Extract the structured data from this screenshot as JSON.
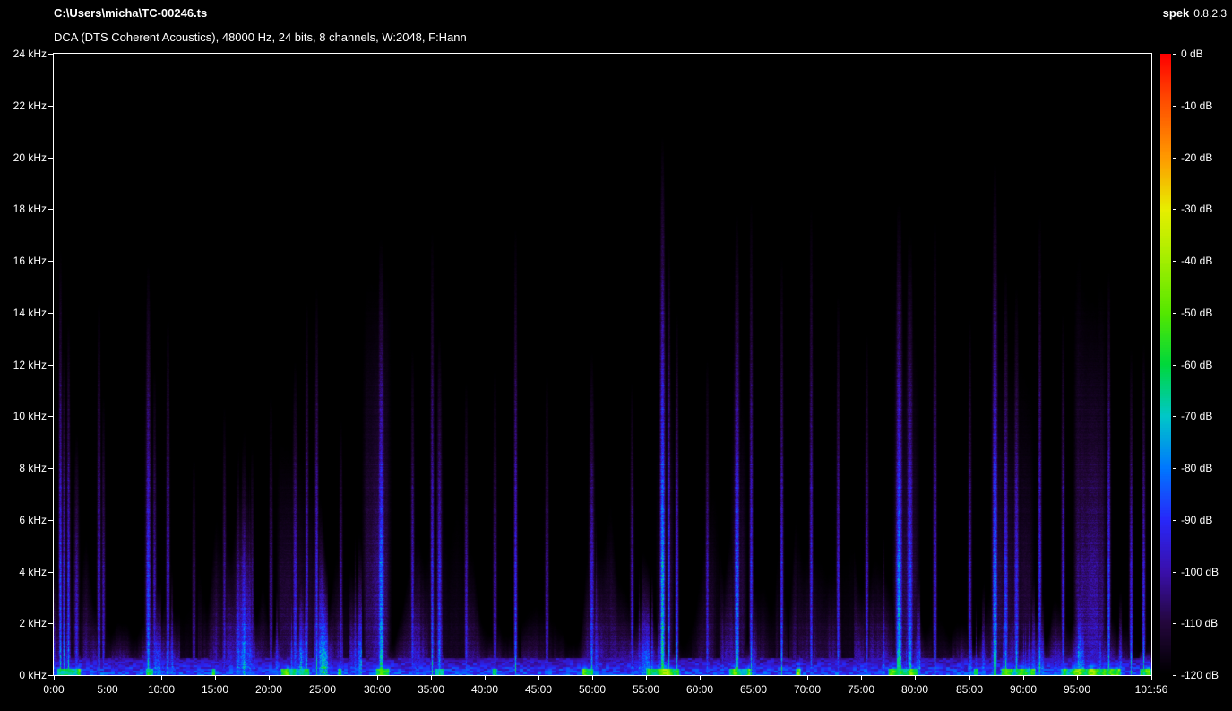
{
  "header": {
    "file_path": "C:\\Users\\micha\\TC-00246.ts",
    "stream_info": "DCA (DTS Coherent Acoustics), 48000 Hz, 24 bits, 8 channels, W:2048, F:Hann",
    "app_name": "spek",
    "app_version": "0.8.2.3"
  },
  "colors": {
    "background": "#000000",
    "text": "#ffffff",
    "plot_border": "#ffffff"
  },
  "chart_data": {
    "type": "heatmap",
    "title": "Audio spectrogram of TC-00246.ts",
    "grid": false,
    "legend_position": "right",
    "x": {
      "unit": "min:sec",
      "duration_minutes": 101.9333,
      "ticks": [
        "0:00",
        "5:00",
        "10:00",
        "15:00",
        "20:00",
        "25:00",
        "30:00",
        "35:00",
        "40:00",
        "45:00",
        "50:00",
        "55:00",
        "60:00",
        "65:00",
        "70:00",
        "75:00",
        "80:00",
        "85:00",
        "90:00",
        "95:00",
        "101:56"
      ]
    },
    "y": {
      "unit": "kHz",
      "min": 0,
      "max": 24,
      "ticks": [
        "24 kHz",
        "22 kHz",
        "20 kHz",
        "18 kHz",
        "16 kHz",
        "14 kHz",
        "12 kHz",
        "10 kHz",
        "8 kHz",
        "6 kHz",
        "4 kHz",
        "2 kHz",
        "0 kHz"
      ]
    },
    "z": {
      "unit": "dB",
      "min": -120,
      "max": 0,
      "ticks": [
        "0 dB",
        "-10 dB",
        "-20 dB",
        "-30 dB",
        "-40 dB",
        "-50 dB",
        "-60 dB",
        "-70 dB",
        "-80 dB",
        "-90 dB",
        "-100 dB",
        "-110 dB",
        "-120 dB"
      ]
    },
    "palette": [
      "#000000",
      "#24073c",
      "#3a10ac",
      "#2828fa",
      "#0078ff",
      "#00c8c8",
      "#00d83c",
      "#55e800",
      "#a2ee00",
      "#e8ee00",
      "#ff9a00",
      "#ff5400",
      "#ff0000"
    ],
    "events": [
      {
        "t": 0.55,
        "f": 16.6,
        "i": 0.34,
        "w": 2
      },
      {
        "t": 0.95,
        "f": 12.8,
        "i": 0.3,
        "w": 2
      },
      {
        "t": 1.3,
        "f": 13.9,
        "i": 0.32,
        "w": 2
      },
      {
        "t": 2.1,
        "f": 9.5,
        "i": 0.26,
        "w": 3
      },
      {
        "t": 4.15,
        "f": 14.6,
        "i": 0.3,
        "w": 2
      },
      {
        "t": 4.6,
        "f": 11.0,
        "i": 0.24,
        "w": 2
      },
      {
        "t": 8.75,
        "f": 16.1,
        "i": 0.34,
        "w": 3
      },
      {
        "t": 9.3,
        "f": 12.0,
        "i": 0.26,
        "w": 2
      },
      {
        "t": 10.55,
        "f": 13.9,
        "i": 0.3,
        "w": 2
      },
      {
        "t": 13.0,
        "f": 8.5,
        "i": 0.22,
        "w": 2
      },
      {
        "t": 15.8,
        "f": 10.5,
        "i": 0.24,
        "w": 2
      },
      {
        "t": 18.4,
        "f": 9.0,
        "i": 0.22,
        "w": 2
      },
      {
        "t": 20.1,
        "f": 11.0,
        "i": 0.24,
        "w": 2
      },
      {
        "t": 22.4,
        "f": 12.3,
        "i": 0.28,
        "w": 3
      },
      {
        "t": 23.5,
        "f": 14.7,
        "i": 0.26,
        "w": 2
      },
      {
        "t": 24.35,
        "f": 15.2,
        "i": 0.3,
        "w": 2
      },
      {
        "t": 26.6,
        "f": 10.0,
        "i": 0.24,
        "w": 2
      },
      {
        "t": 30.4,
        "f": 17.0,
        "i": 0.4,
        "w": 4
      },
      {
        "t": 33.3,
        "f": 12.8,
        "i": 0.28,
        "w": 2
      },
      {
        "t": 35.15,
        "f": 17.4,
        "i": 0.3,
        "w": 2
      },
      {
        "t": 35.75,
        "f": 13.3,
        "i": 0.32,
        "w": 3
      },
      {
        "t": 38.3,
        "f": 11.5,
        "i": 0.26,
        "w": 2
      },
      {
        "t": 40.9,
        "f": 12.0,
        "i": 0.26,
        "w": 2
      },
      {
        "t": 42.85,
        "f": 17.5,
        "i": 0.3,
        "w": 2
      },
      {
        "t": 45.8,
        "f": 11.8,
        "i": 0.25,
        "w": 2
      },
      {
        "t": 49.9,
        "f": 12.6,
        "i": 0.3,
        "w": 3
      },
      {
        "t": 53.7,
        "f": 11.5,
        "i": 0.26,
        "w": 2
      },
      {
        "t": 56.5,
        "f": 21.0,
        "i": 0.46,
        "w": 3
      },
      {
        "t": 57.1,
        "f": 17.0,
        "i": 0.32,
        "w": 2
      },
      {
        "t": 57.8,
        "f": 14.2,
        "i": 0.3,
        "w": 2
      },
      {
        "t": 60.7,
        "f": 12.4,
        "i": 0.27,
        "w": 2
      },
      {
        "t": 63.4,
        "f": 18.0,
        "i": 0.4,
        "w": 3
      },
      {
        "t": 64.7,
        "f": 18.6,
        "i": 0.3,
        "w": 2
      },
      {
        "t": 67.6,
        "f": 16.4,
        "i": 0.3,
        "w": 2
      },
      {
        "t": 70.3,
        "f": 18.4,
        "i": 0.28,
        "w": 2
      },
      {
        "t": 72.8,
        "f": 15.0,
        "i": 0.28,
        "w": 2
      },
      {
        "t": 75.5,
        "f": 13.4,
        "i": 0.26,
        "w": 2
      },
      {
        "t": 78.5,
        "f": 18.4,
        "i": 0.42,
        "w": 4
      },
      {
        "t": 79.5,
        "f": 17.2,
        "i": 0.34,
        "w": 4
      },
      {
        "t": 81.8,
        "f": 17.8,
        "i": 0.3,
        "w": 2
      },
      {
        "t": 85.0,
        "f": 14.0,
        "i": 0.26,
        "w": 2
      },
      {
        "t": 87.4,
        "f": 20.0,
        "i": 0.42,
        "w": 3
      },
      {
        "t": 88.4,
        "f": 15.8,
        "i": 0.32,
        "w": 3
      },
      {
        "t": 89.4,
        "f": 15.2,
        "i": 0.3,
        "w": 3
      },
      {
        "t": 91.5,
        "f": 18.1,
        "i": 0.3,
        "w": 2
      },
      {
        "t": 93.7,
        "f": 14.2,
        "i": 0.28,
        "w": 2
      },
      {
        "t": 97.9,
        "f": 15.8,
        "i": 0.34,
        "w": 2
      },
      {
        "t": 100.0,
        "f": 12.8,
        "i": 0.3,
        "w": 2
      },
      {
        "t": 101.2,
        "f": 13.0,
        "i": 0.3,
        "w": 2
      }
    ],
    "patches": [
      {
        "t0": 28.6,
        "t1": 31.3,
        "f": 15.8,
        "i": 0.14
      },
      {
        "t0": 20.6,
        "t1": 24.6,
        "f": 9.0,
        "i": 0.1
      },
      {
        "t0": 55.9,
        "t1": 57.6,
        "f": 12.0,
        "i": 0.12
      },
      {
        "t0": 62.8,
        "t1": 64.3,
        "f": 12.0,
        "i": 0.12
      },
      {
        "t0": 77.9,
        "t1": 80.4,
        "f": 13.5,
        "i": 0.13
      },
      {
        "t0": 87.0,
        "t1": 91.0,
        "f": 12.5,
        "i": 0.11
      },
      {
        "t0": 94.7,
        "t1": 97.8,
        "f": 16.2,
        "i": 0.17
      },
      {
        "t0": 95.0,
        "t1": 97.3,
        "f": 15.2,
        "i": 0.22
      }
    ],
    "green_segments": [
      [
        0.2,
        2.6
      ],
      [
        8.4,
        9.3
      ],
      [
        14.6,
        15.1
      ],
      [
        21.0,
        23.8
      ],
      [
        26.3,
        26.8
      ],
      [
        29.8,
        31.2
      ],
      [
        35.3,
        36.3
      ],
      [
        40.6,
        41.2
      ],
      [
        48.9,
        50.2
      ],
      [
        54.8,
        58.2
      ],
      [
        62.6,
        64.7
      ],
      [
        68.8,
        69.4
      ],
      [
        77.4,
        80.3
      ],
      [
        85.3,
        85.9
      ],
      [
        87.9,
        91.2
      ],
      [
        93.4,
        99.2
      ],
      [
        100.8,
        101.9
      ]
    ],
    "activity": [
      [
        0,
        2.8,
        1.15
      ],
      [
        8,
        10.5,
        1.1
      ],
      [
        11,
        15,
        0.8
      ],
      [
        21.5,
        31.5,
        1.15
      ],
      [
        32,
        35,
        0.85
      ],
      [
        35,
        36.5,
        1.1
      ],
      [
        41,
        49,
        0.7
      ],
      [
        49,
        50.5,
        1.05
      ],
      [
        51,
        54,
        0.8
      ],
      [
        54.5,
        58.5,
        1.2
      ],
      [
        59,
        62,
        0.8
      ],
      [
        62,
        65,
        1.15
      ],
      [
        65.5,
        77,
        0.75
      ],
      [
        77,
        80.5,
        1.2
      ],
      [
        81,
        87,
        0.9
      ],
      [
        87,
        91.5,
        1.2
      ],
      [
        93,
        99.5,
        1.2
      ],
      [
        99.5,
        101.94,
        0.95
      ]
    ]
  }
}
